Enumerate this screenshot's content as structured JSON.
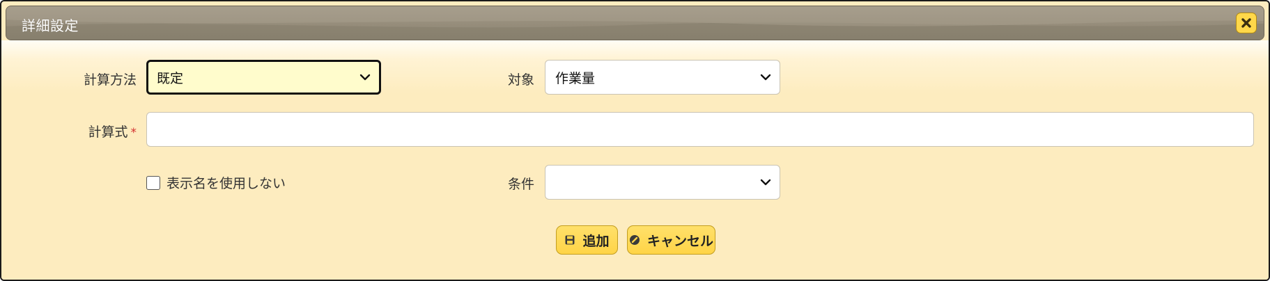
{
  "dialog": {
    "title": "詳細設定",
    "close_icon": "close-icon"
  },
  "form": {
    "calc_method": {
      "label": "計算方法",
      "value": "既定"
    },
    "target": {
      "label": "対象",
      "value": "作業量"
    },
    "formula": {
      "label": "計算式",
      "required_mark": "*",
      "value": ""
    },
    "hide_display_name": {
      "label": "表示名を使用しない",
      "checked": false
    },
    "condition": {
      "label": "条件",
      "value": ""
    }
  },
  "buttons": {
    "add": {
      "label": "追加",
      "icon": "save-icon"
    },
    "cancel": {
      "label": "キャンセル",
      "icon": "cancel-icon"
    }
  },
  "colors": {
    "dialog_bg": "#fdecbf",
    "titlebar": "#978e7c",
    "button": "#ffd447",
    "focused_select": "#fffccc",
    "required": "#d32f2f"
  }
}
